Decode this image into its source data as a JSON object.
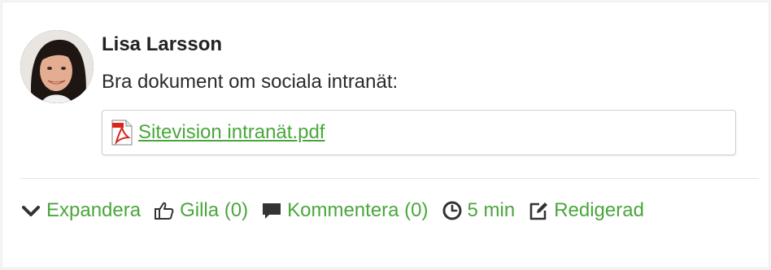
{
  "post": {
    "author": "Lisa Larsson",
    "text": "Bra dokument om sociala intranät:",
    "attachment": {
      "name": "Sitevision intranät.pdf",
      "icon": "pdf-icon"
    }
  },
  "actions": {
    "expand": "Expandera",
    "like": "Gilla (0)",
    "comment": "Kommentera (0)",
    "time": "5 min",
    "edited": "Redigerad"
  },
  "colors": {
    "link": "#4aa63c",
    "text": "#2b2b2b",
    "icon": "#333333",
    "pdf_red": "#d9251c"
  }
}
